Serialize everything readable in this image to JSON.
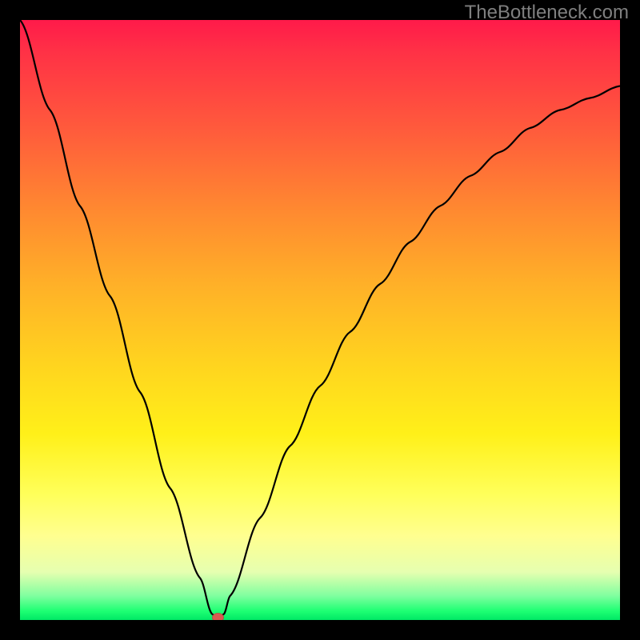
{
  "watermark": "TheBottleneck.com",
  "chart_data": {
    "type": "line",
    "title": "",
    "xlabel": "",
    "ylabel": "",
    "xlim": [
      0,
      100
    ],
    "ylim": [
      0,
      100
    ],
    "x": [
      0,
      5,
      10,
      15,
      20,
      25,
      30,
      32,
      33,
      34,
      35,
      40,
      45,
      50,
      55,
      60,
      65,
      70,
      75,
      80,
      85,
      90,
      95,
      100
    ],
    "values": [
      100,
      85,
      69,
      54,
      38,
      22,
      7,
      1,
      0,
      1,
      4,
      17,
      29,
      39,
      48,
      56,
      63,
      69,
      74,
      78,
      82,
      85,
      87,
      89
    ],
    "min_marker": {
      "x": 33,
      "y": 0,
      "label": ""
    },
    "gradient_background": {
      "orientation": "vertical_top_to_bottom",
      "stops": [
        {
          "pos": 0.0,
          "color": "#ff1a4a"
        },
        {
          "pos": 0.18,
          "color": "#ff5a3c"
        },
        {
          "pos": 0.44,
          "color": "#ffb028"
        },
        {
          "pos": 0.69,
          "color": "#fff019"
        },
        {
          "pos": 0.86,
          "color": "#ffff90"
        },
        {
          "pos": 0.96,
          "color": "#7fff9f"
        },
        {
          "pos": 1.0,
          "color": "#00e865"
        }
      ]
    }
  }
}
